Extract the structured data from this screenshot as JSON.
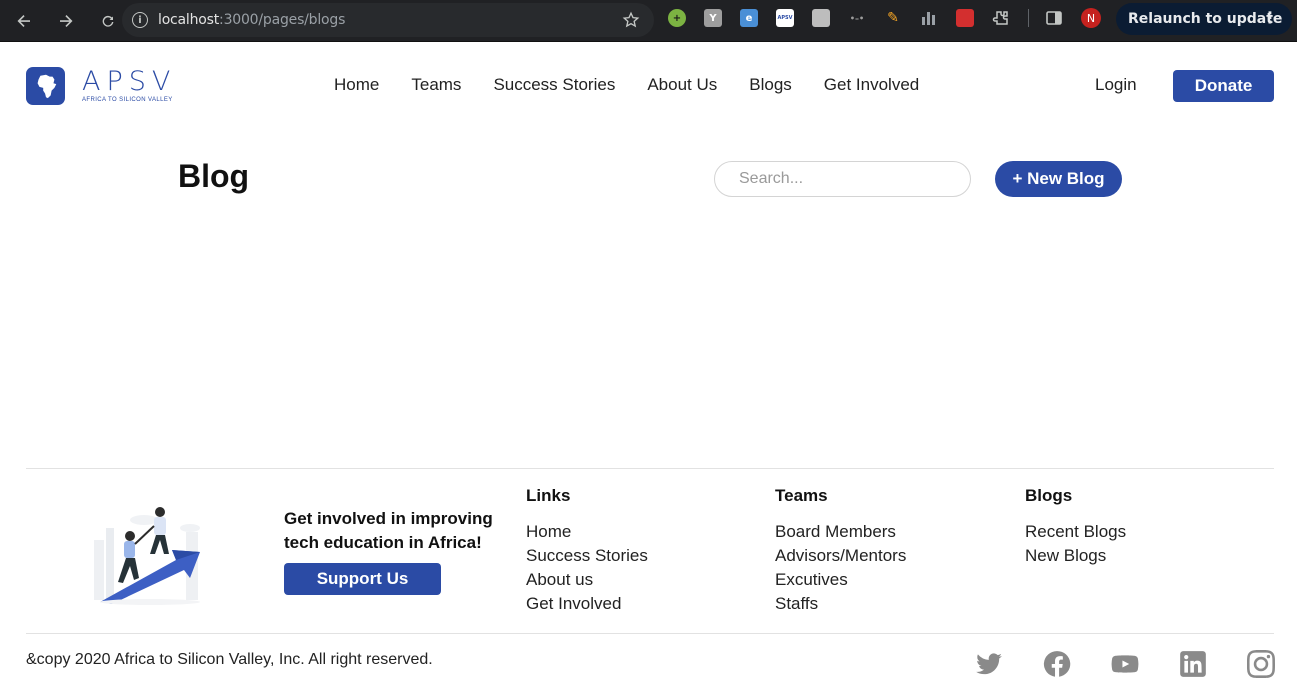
{
  "browser": {
    "url_host": "localhost",
    "url_path": ":3000/pages/blogs",
    "avatar_letter": "N",
    "relaunch_label": "Relaunch to update",
    "extensions": [
      "extension-green-plus",
      "extension-y",
      "extension-e",
      "extension-apsv",
      "extension-puzzle-grey",
      "extension-dots",
      "extension-pen",
      "extension-bars",
      "extension-red",
      "extensions-menu-icon",
      "sidebar-icon"
    ]
  },
  "header": {
    "logo_text": "APSV",
    "logo_subtitle": "AFRICA TO SILICON VALLEY",
    "nav": [
      "Home",
      "Teams",
      "Success Stories",
      "About Us",
      "Blogs",
      "Get Involved"
    ],
    "login_label": "Login",
    "donate_label": "Donate",
    "brand_color": "#2b4ba5"
  },
  "main": {
    "title": "Blog",
    "search_placeholder": "Search...",
    "new_blog_label": "+ New Blog"
  },
  "footer": {
    "cta_line1": "Get involved in improving",
    "cta_line2": "tech education in Africa!",
    "support_label": "Support Us",
    "columns": [
      {
        "title": "Links",
        "items": [
          "Home",
          "Success Stories",
          "About us",
          "Get Involved"
        ]
      },
      {
        "title": "Teams",
        "items": [
          "Board Members",
          "Advisors/Mentors",
          "Excutives",
          "Staffs"
        ]
      },
      {
        "title": "Blogs",
        "items": [
          "Recent Blogs",
          "New Blogs"
        ]
      }
    ],
    "copyright": "&copy 2020 Africa to Silicon Valley, Inc. All right reserved.",
    "socials": [
      "twitter-icon",
      "facebook-icon",
      "youtube-icon",
      "linkedin-icon",
      "instagram-icon"
    ]
  }
}
